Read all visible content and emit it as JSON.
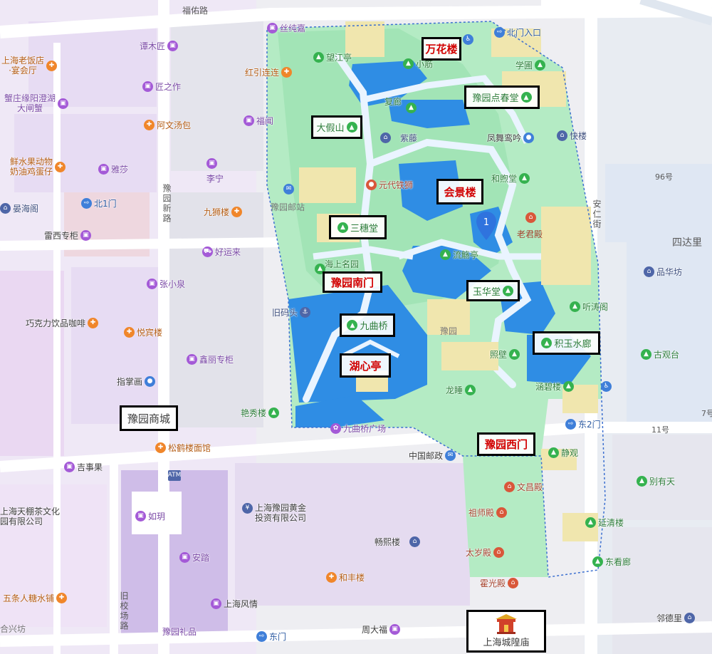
{
  "streets": {
    "fuyou_road": "福佑路",
    "yuyuan_new_road": "豫园新路",
    "anren_street": "安仁街",
    "jiuxiao_field_road": "旧校场路",
    "sidali": "四达里",
    "no96": "96号",
    "no11": "11号",
    "no7": "7号"
  },
  "labeled_boxes": {
    "wanhualou": "万花楼",
    "dianchuntang": "豫园点春堂",
    "dajiashan": "大假山",
    "huijinglou": "会景楼",
    "sansuitang": "三穗堂",
    "south_gate": "豫园南门",
    "yuhuatang": "玉华堂",
    "jiuqu_bridge": "九曲桥",
    "jiyu_corridor": "积玉水廊",
    "huxinting": "湖心亭",
    "west_gate": "豫园西门",
    "yuyuan_mall": "豫园商城",
    "chenghuang_temple": "上海城隍庙"
  },
  "pois": {
    "sichunjia": "丝纯嘉",
    "north_gate_entrance": "北门入口",
    "wangjiangting": "望江亭",
    "hongyinlianlian": "红引连连",
    "xiaoxie": "小筋",
    "xuepu": "学圃",
    "fulang": "复廊",
    "fuwen": "福闻",
    "ziteng": "紫藤",
    "fengwuluanyin": "凤舞鸾吟",
    "kuailou": "快楼",
    "yuandai_tieshi": "元代铁狮",
    "hexitang": "和煦堂",
    "yuyuan_post_station": "豫园邮站",
    "laojundian": "老君殿",
    "haishangmingyuan": "海上名园",
    "liushangting": "流觞亭",
    "pinfangfang": "品华坊",
    "jiumatou": "旧码头",
    "tingtaoge": "听涛阁",
    "yuyuan_label": "豫园",
    "zhaobi": "照壁",
    "gujingtai": "古观台",
    "hanbilou": "涵碧楼",
    "longbi": "龙睡",
    "yanxiulou": "艳秀楼",
    "jiuqu_plaza": "九曲桥广场",
    "east_gate_2": "东2门",
    "china_post": "中国邮政",
    "jingguan": "静观",
    "bieyoutian": "别有天",
    "wenchangdian": "文昌殿",
    "yanqinglou": "延清楼",
    "zushidian": "祖师殿",
    "changxilou": "畅熙楼",
    "taisuidian": "太岁殿",
    "dongkange": "东看廊",
    "huoguangdian": "霍光殿",
    "hefenglou": "和丰楼",
    "zhoudafu": "周大福",
    "east_gate": "东门",
    "yuyuan_gifts": "豫园礼品",
    "shanghai_style": "上海风情",
    "anta": "安踏",
    "ruyue": "如玥",
    "gold_company": "上海豫园黄金\n投资有限公司",
    "tanmujiang": "谭木匠",
    "shanghai_old_restaurant": "上海老饭店\n·宴会厅",
    "jiangzhizhi": "匠之作",
    "crab_yangcheng": "蟹庄缘阳澄湖\n大闸蟹",
    "awentang": "阿文汤包",
    "fresh_fruit_cake": "鲜水果动物\n奶油鸡蛋仔",
    "yasha": "雅莎",
    "lining": "李宁",
    "north_gate_1": "北1门",
    "yanhaige": "晏海阁",
    "jiushilou": "九狮楼",
    "leixi_counter": "雷西专柜",
    "haoyunlai": "好运来",
    "zhangxiaoquan": "张小泉",
    "chocolate_cafe": "巧克力饮品咖啡",
    "yuebinlou": "悦宾楼",
    "xinli_counter": "鑫丽专柜",
    "zhizhanghua": "指掌画",
    "songhelou": "松鹤楼面馆",
    "jishiguo": "吉事果",
    "tianpeng_tea": "上海天棚茶文化\n园有限公司",
    "wutiaoren": "五条人糖水铺",
    "hexingfang": "合兴坊",
    "lindeli": "邻德里",
    "atm": "ATM"
  },
  "marker": {
    "number": "1"
  },
  "colors": {
    "garden_green": "#9fe3b4",
    "water_blue": "#2f8de4",
    "road": "#ffffff",
    "building": "#d8d8e2",
    "shop_purple": "#e9dcf6",
    "label_red": "#d10000",
    "marker_blue": "#2f73de"
  }
}
